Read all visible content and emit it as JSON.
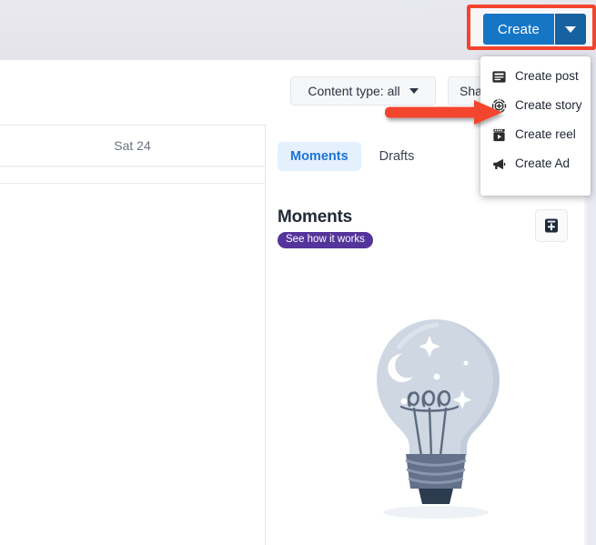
{
  "window": {
    "background_top_color": "#e8e7ee",
    "page_background": "#ffffff"
  },
  "header": {
    "create_button": {
      "label": "Create",
      "color": "#1576c6",
      "caret_color": "#16619f",
      "highlight_color": "#f4442e",
      "caret_icon": "chevron-down-icon"
    }
  },
  "create_menu": {
    "items": [
      {
        "label": "Create post",
        "icon": "post-icon"
      },
      {
        "label": "Create story",
        "icon": "story-plus-icon"
      },
      {
        "label": "Create reel",
        "icon": "reel-icon"
      },
      {
        "label": "Create Ad",
        "icon": "megaphone-icon"
      }
    ]
  },
  "filters": [
    {
      "label": "Content type: all",
      "icon": "chevron-down-icon",
      "name": "content-type-filter"
    },
    {
      "label": "Sha",
      "icon": "",
      "name": "share-filter"
    }
  ],
  "calendar": {
    "day_label": "Sat 24"
  },
  "main": {
    "tabs": [
      {
        "label": "Moments",
        "active": true
      },
      {
        "label": "Drafts",
        "active": false
      }
    ],
    "section_title": "Moments",
    "badge_label": "See how it works",
    "badge_color": "#54349b",
    "add_button_icon": "add-moment-icon",
    "empty_state_illustration": "lightbulb-night-sky-illustration"
  },
  "annotation": {
    "arrow_color": "#f4442e",
    "points_to": "Create story"
  }
}
